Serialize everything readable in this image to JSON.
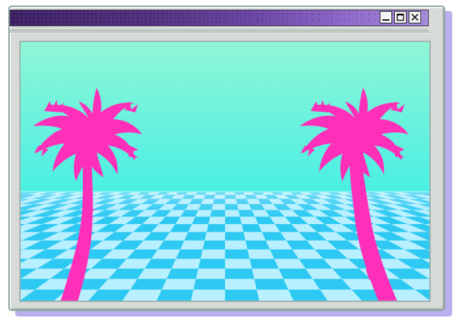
{
  "window": {
    "controls": [
      {
        "name": "minimize",
        "icon": "minimize-icon"
      },
      {
        "name": "maximize",
        "icon": "maximize-icon"
      },
      {
        "name": "close",
        "icon": "close-icon"
      }
    ]
  },
  "scene": {
    "image": "vaporwave-palm-trees-checkered-floor",
    "sky_top": "#8ff6d6",
    "sky_bottom": "#49efe3",
    "floor_light": "#b9f0ff",
    "floor_dark": "#2ec9f2",
    "palm_color": "#ff2fb9"
  }
}
